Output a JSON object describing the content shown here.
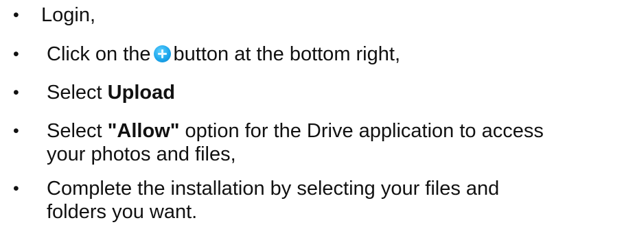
{
  "steps": [
    {
      "text": "Login,"
    },
    {
      "before": "Click on the",
      "icon": "plus-circle-icon",
      "after": "button at the bottom right,"
    },
    {
      "prefix": "Select ",
      "bold": "Upload"
    },
    {
      "prefix": "Select ",
      "bold": "\"Allow\"",
      "suffix": " option for the Drive application to access",
      "line2": "your photos and files,"
    },
    {
      "line1": "Complete the installation by selecting your files and",
      "line2": "folders you want."
    }
  ],
  "bullet_char": "•",
  "colors": {
    "text": "#111111",
    "icon_blue": "#1ea7ec"
  }
}
